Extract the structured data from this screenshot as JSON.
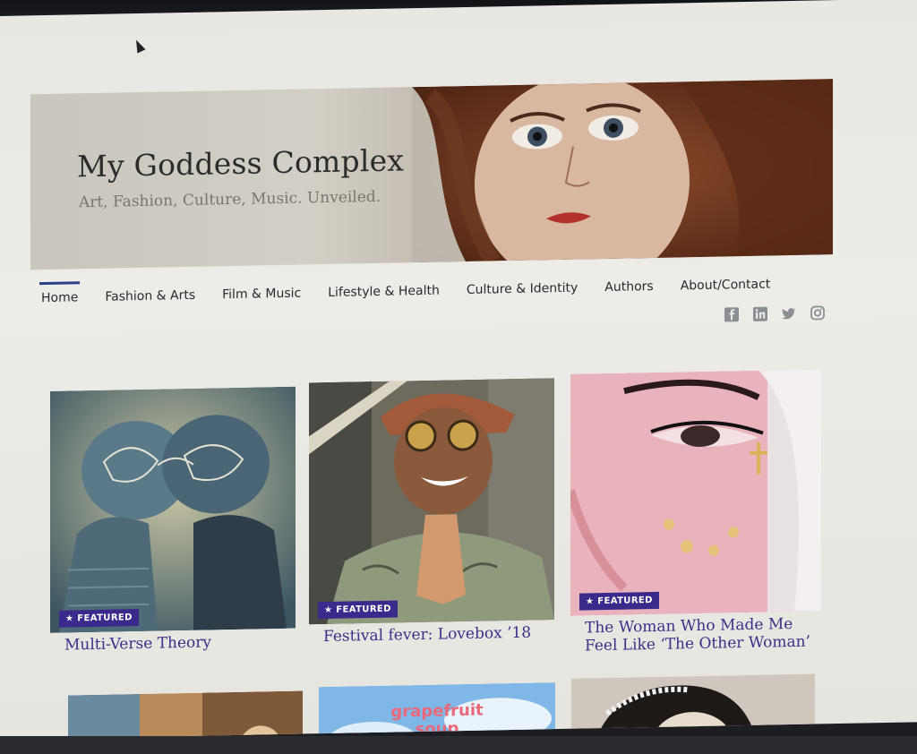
{
  "site": {
    "title": "My Goddess Complex",
    "tagline": "Art, Fashion, Culture, Music. Unveiled."
  },
  "nav": {
    "items": [
      {
        "label": "Home",
        "active": true
      },
      {
        "label": "Fashion & Arts",
        "active": false
      },
      {
        "label": "Film & Music",
        "active": false
      },
      {
        "label": "Lifestyle & Health",
        "active": false
      },
      {
        "label": "Culture & Identity",
        "active": false
      },
      {
        "label": "Authors",
        "active": false
      },
      {
        "label": "About/Contact",
        "active": false
      }
    ]
  },
  "social": [
    "facebook-icon",
    "linkedin-icon",
    "twitter-icon",
    "instagram-icon"
  ],
  "cards": [
    {
      "badge": "★ FEATURED",
      "title": "Multi-Verse Theory"
    },
    {
      "badge": "★ FEATURED",
      "title": "Festival fever: Lovebox ’18"
    },
    {
      "badge": "★ FEATURED",
      "title": "The Woman Who Made Me Feel Like ‘The Other Woman’"
    }
  ],
  "row2": [
    {
      "image_text": "grapefruit soup"
    }
  ],
  "colors": {
    "accent": "#2c3f86",
    "badge": "#3a2a8c",
    "title_link": "#3b2f8a"
  }
}
